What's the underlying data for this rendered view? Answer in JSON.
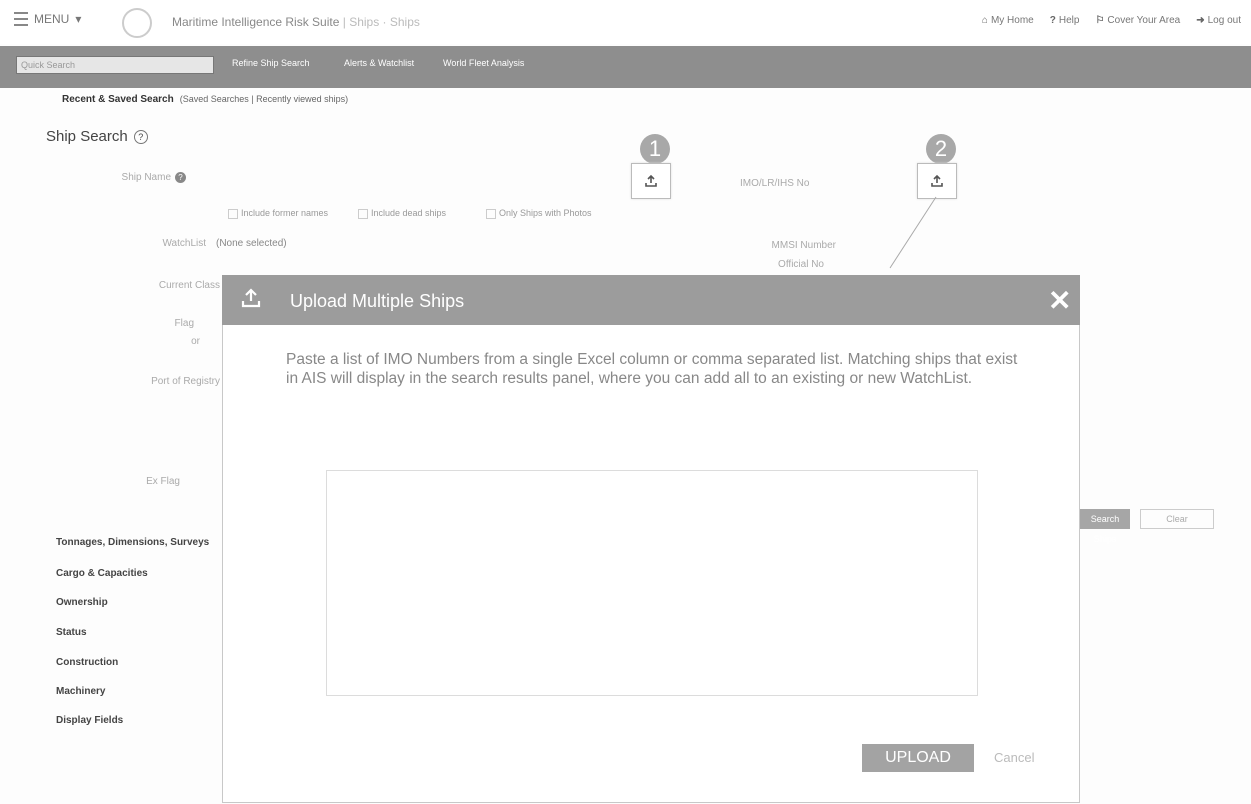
{
  "topbar": {
    "menu_label": "MENU",
    "app_title": "Maritime Intelligence Risk Suite",
    "crumb": "| Ships · Ships",
    "links": [
      {
        "label": "My Home",
        "icon": "home-icon"
      },
      {
        "label": "Help",
        "icon": "help-icon"
      },
      {
        "label": "Cover Your Area",
        "icon": "area-icon"
      },
      {
        "label": "Log out",
        "icon": "logout-icon"
      }
    ]
  },
  "nav": {
    "quick_search_placeholder": "Quick Search",
    "tabs": [
      "Refine Ship Search",
      "Alerts & Watchlist",
      "World Fleet Analysis"
    ]
  },
  "recent": {
    "label": "Recent & Saved Search",
    "sub": "(Saved Searches | Recently viewed ships)"
  },
  "search": {
    "title": "Ship Search",
    "ship_name_label": "Ship Name",
    "imo_label": "IMO/LR/IHS No",
    "checkboxes": [
      "Include former names",
      "Include dead ships",
      "Only Ships with Photos"
    ],
    "watchlist_label": "WatchList",
    "watchlist_value": "(None selected)",
    "mmsi_label": "MMSI Number",
    "official_label": "Official No",
    "current_class_label": "Current Class",
    "flag_label": "Flag",
    "or_label": "or",
    "port_label": "Port of Registry",
    "exflag_label": "Ex Flag",
    "search_ships_button": "Search Ships",
    "clear_button": "Clear"
  },
  "sections": [
    "Tonnages, Dimensions, Surveys",
    "Cargo & Capacities",
    "Ownership",
    "Status",
    "Construction",
    "Machinery",
    "Display Fields"
  ],
  "callouts": [
    "1",
    "2"
  ],
  "modal": {
    "title": "Upload Multiple Ships",
    "close": "✕",
    "instructions": "Paste a list of IMO Numbers from a single Excel column or comma separated list. Matching ships that exist in AIS will display in the search results panel, where you can add all to an existing or new WatchList.",
    "textarea_value": "",
    "upload_button": "UPLOAD",
    "cancel_button": "Cancel"
  }
}
